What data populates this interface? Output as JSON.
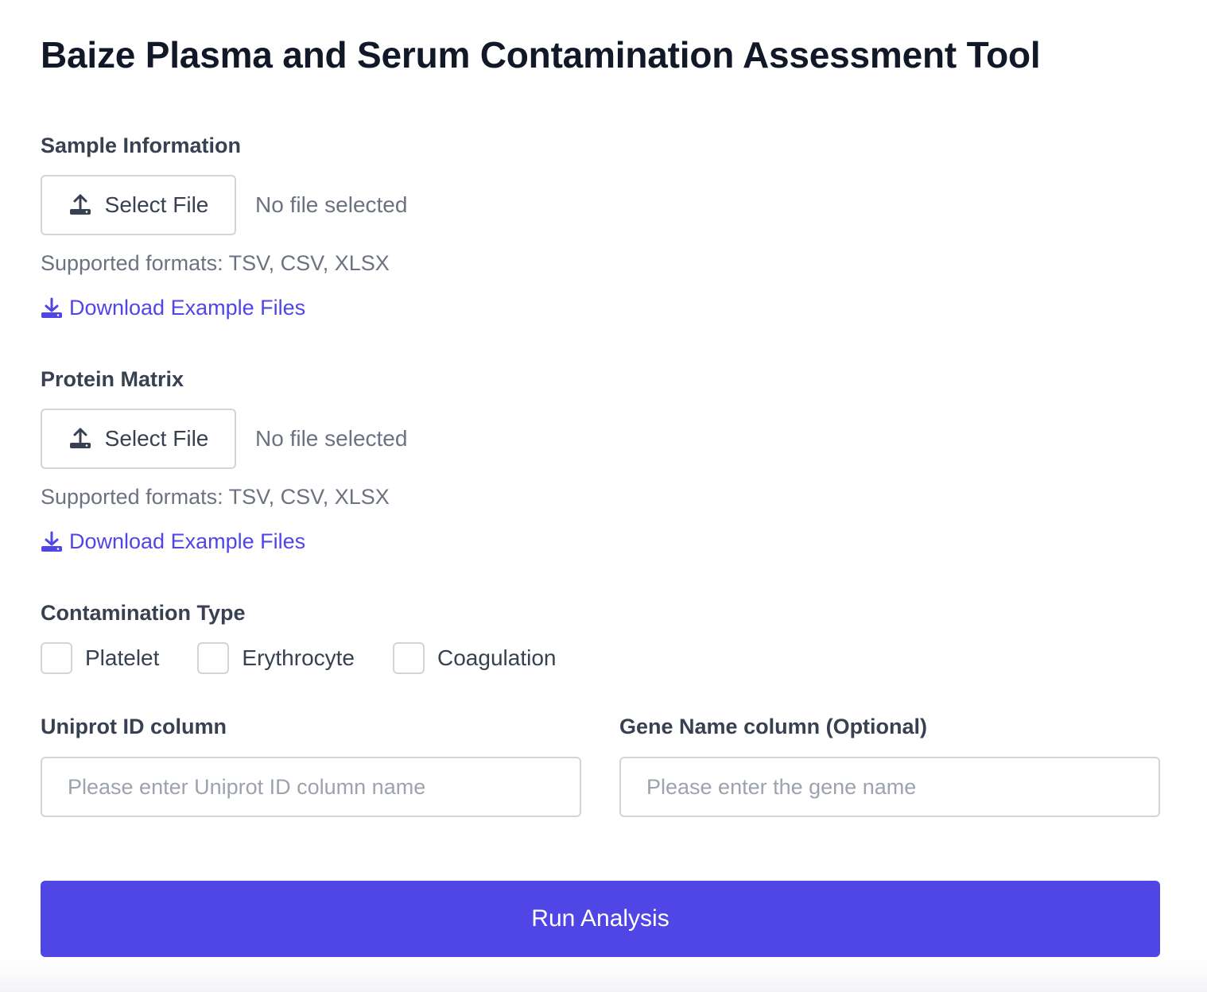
{
  "title": "Baize Plasma and Serum Contamination Assessment Tool",
  "sample_information": {
    "label": "Sample Information",
    "select_button_label": "Select File",
    "file_status": "No file selected",
    "supported_formats": "Supported formats: TSV, CSV, XLSX",
    "download_link": "Download Example Files",
    "upload_icon": "upload-icon",
    "download_icon": "download-icon"
  },
  "protein_matrix": {
    "label": "Protein Matrix",
    "select_button_label": "Select File",
    "file_status": "No file selected",
    "supported_formats": "Supported formats: TSV, CSV, XLSX",
    "download_link": "Download Example Files",
    "upload_icon": "upload-icon",
    "download_icon": "download-icon"
  },
  "contamination_type": {
    "label": "Contamination Type",
    "options": [
      {
        "label": "Platelet",
        "checked": false
      },
      {
        "label": "Erythrocyte",
        "checked": false
      },
      {
        "label": "Coagulation",
        "checked": false
      }
    ]
  },
  "uniprot_column": {
    "label": "Uniprot ID column",
    "value": "",
    "placeholder": "Please enter Uniprot ID column name"
  },
  "gene_column": {
    "label": "Gene Name column (Optional)",
    "value": "",
    "placeholder": "Please enter the gene name"
  },
  "run_button_label": "Run Analysis",
  "colors": {
    "accent": "#4f46e5",
    "border": "#d1d5db",
    "muted_text": "#6b7280",
    "heading": "#111827"
  }
}
